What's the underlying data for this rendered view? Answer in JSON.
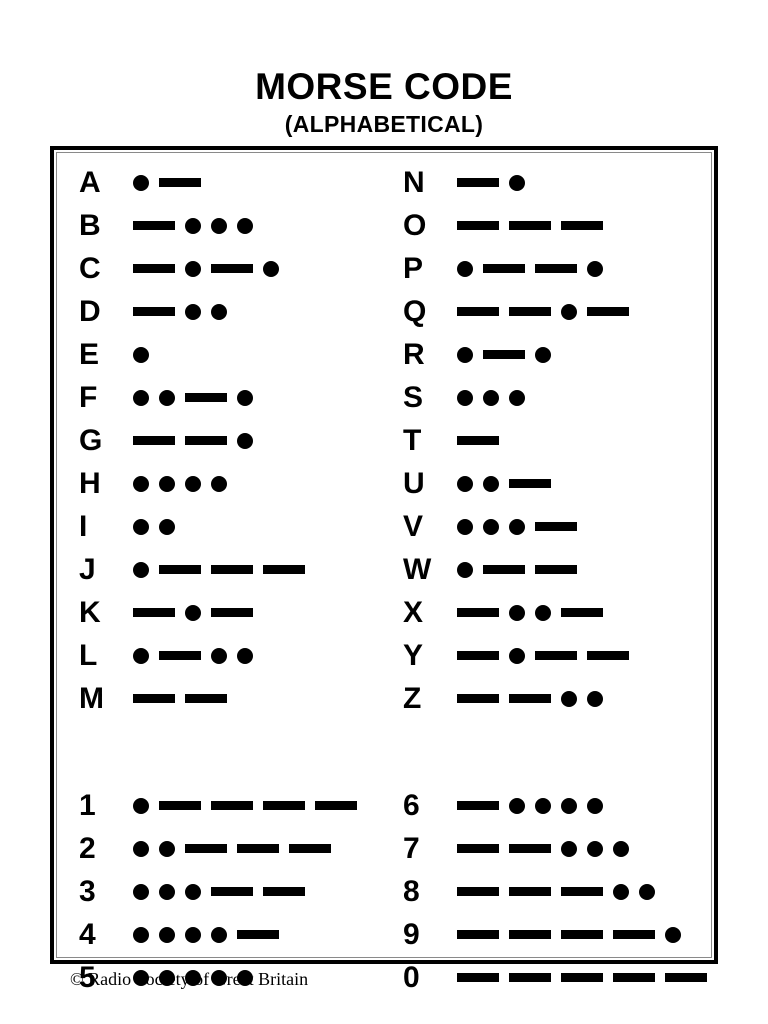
{
  "header": {
    "title": "MORSE CODE",
    "subtitle": "(ALPHABETICAL)"
  },
  "footer": {
    "credit": "© Radio Society of Great Britain"
  },
  "colors": {
    "ink": "#000000",
    "paper": "#ffffff",
    "frame_outer": "#000000",
    "frame_inner": "#8a8a8a"
  },
  "symbols": {
    "dot": "•",
    "dash": "—"
  },
  "chart_data": {
    "type": "table",
    "title": "MORSE CODE",
    "subtitle": "(ALPHABETICAL)",
    "columns": [
      "character",
      "code"
    ],
    "left_column": {
      "letters": [
        {
          "character": "A",
          "code": ".-",
          "symbols": [
            "dot",
            "dash"
          ]
        },
        {
          "character": "B",
          "code": "-...",
          "symbols": [
            "dash",
            "dot",
            "dot",
            "dot"
          ]
        },
        {
          "character": "C",
          "code": "-.-.",
          "symbols": [
            "dash",
            "dot",
            "dash",
            "dot"
          ]
        },
        {
          "character": "D",
          "code": "-..",
          "symbols": [
            "dash",
            "dot",
            "dot"
          ]
        },
        {
          "character": "E",
          "code": ".",
          "symbols": [
            "dot"
          ]
        },
        {
          "character": "F",
          "code": "..-.",
          "symbols": [
            "dot",
            "dot",
            "dash",
            "dot"
          ]
        },
        {
          "character": "G",
          "code": "--.",
          "symbols": [
            "dash",
            "dash",
            "dot"
          ]
        },
        {
          "character": "H",
          "code": "....",
          "symbols": [
            "dot",
            "dot",
            "dot",
            "dot"
          ]
        },
        {
          "character": "I",
          "code": "..",
          "symbols": [
            "dot",
            "dot"
          ]
        },
        {
          "character": "J",
          "code": ".---",
          "symbols": [
            "dot",
            "dash",
            "dash",
            "dash"
          ]
        },
        {
          "character": "K",
          "code": "-.-",
          "symbols": [
            "dash",
            "dot",
            "dash"
          ]
        },
        {
          "character": "L",
          "code": ".-..",
          "symbols": [
            "dot",
            "dash",
            "dot",
            "dot"
          ]
        },
        {
          "character": "M",
          "code": "--",
          "symbols": [
            "dash",
            "dash"
          ]
        }
      ],
      "digits": [
        {
          "character": "1",
          "code": ".----",
          "symbols": [
            "dot",
            "dash",
            "dash",
            "dash",
            "dash"
          ]
        },
        {
          "character": "2",
          "code": "..---",
          "symbols": [
            "dot",
            "dot",
            "dash",
            "dash",
            "dash"
          ]
        },
        {
          "character": "3",
          "code": "...--",
          "symbols": [
            "dot",
            "dot",
            "dot",
            "dash",
            "dash"
          ]
        },
        {
          "character": "4",
          "code": "....-",
          "symbols": [
            "dot",
            "dot",
            "dot",
            "dot",
            "dash"
          ]
        },
        {
          "character": "5",
          "code": ".....",
          "symbols": [
            "dot",
            "dot",
            "dot",
            "dot",
            "dot"
          ]
        }
      ]
    },
    "right_column": {
      "letters": [
        {
          "character": "N",
          "code": "-.",
          "symbols": [
            "dash",
            "dot"
          ]
        },
        {
          "character": "O",
          "code": "---",
          "symbols": [
            "dash",
            "dash",
            "dash"
          ]
        },
        {
          "character": "P",
          "code": ".--.",
          "symbols": [
            "dot",
            "dash",
            "dash",
            "dot"
          ]
        },
        {
          "character": "Q",
          "code": "--.-",
          "symbols": [
            "dash",
            "dash",
            "dot",
            "dash"
          ]
        },
        {
          "character": "R",
          "code": ".-.",
          "symbols": [
            "dot",
            "dash",
            "dot"
          ]
        },
        {
          "character": "S",
          "code": "...",
          "symbols": [
            "dot",
            "dot",
            "dot"
          ]
        },
        {
          "character": "T",
          "code": "-",
          "symbols": [
            "dash"
          ]
        },
        {
          "character": "U",
          "code": "..-",
          "symbols": [
            "dot",
            "dot",
            "dash"
          ]
        },
        {
          "character": "V",
          "code": "...-",
          "symbols": [
            "dot",
            "dot",
            "dot",
            "dash"
          ]
        },
        {
          "character": "W",
          "code": ".--",
          "symbols": [
            "dot",
            "dash",
            "dash"
          ]
        },
        {
          "character": "X",
          "code": "-..-",
          "symbols": [
            "dash",
            "dot",
            "dot",
            "dash"
          ]
        },
        {
          "character": "Y",
          "code": "-.--",
          "symbols": [
            "dash",
            "dot",
            "dash",
            "dash"
          ]
        },
        {
          "character": "Z",
          "code": "--..",
          "symbols": [
            "dash",
            "dash",
            "dot",
            "dot"
          ]
        }
      ],
      "digits": [
        {
          "character": "6",
          "code": "-....",
          "symbols": [
            "dash",
            "dot",
            "dot",
            "dot",
            "dot"
          ]
        },
        {
          "character": "7",
          "code": "--...",
          "symbols": [
            "dash",
            "dash",
            "dot",
            "dot",
            "dot"
          ]
        },
        {
          "character": "8",
          "code": "---..",
          "symbols": [
            "dash",
            "dash",
            "dash",
            "dot",
            "dot"
          ]
        },
        {
          "character": "9",
          "code": "----.",
          "symbols": [
            "dash",
            "dash",
            "dash",
            "dash",
            "dot"
          ]
        },
        {
          "character": "0",
          "code": "-----",
          "symbols": [
            "dash",
            "dash",
            "dash",
            "dash",
            "dash"
          ]
        }
      ]
    }
  }
}
